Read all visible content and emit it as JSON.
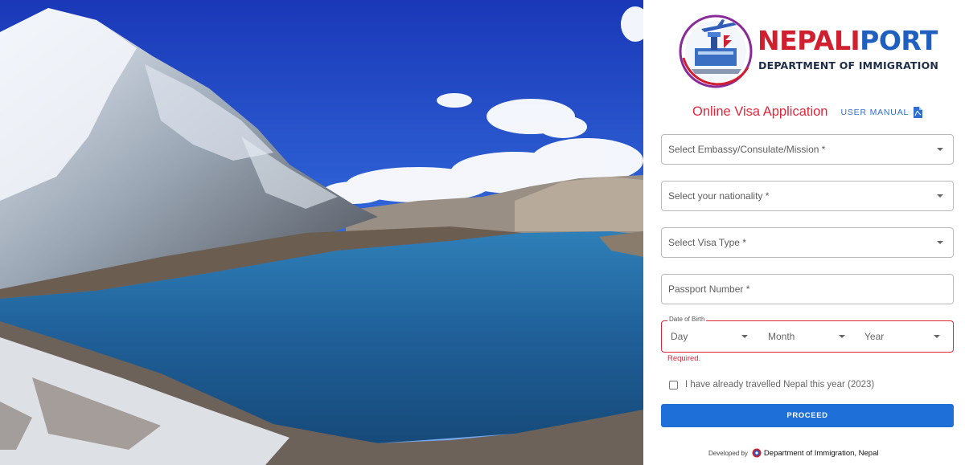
{
  "brand": {
    "title_part1": "NEPALI",
    "title_part2": "PORT",
    "subtitle": "DEPARTMENT OF IMMIGRATION"
  },
  "form": {
    "title": "Online Visa Application",
    "user_manual_label": "USER MANUAL",
    "embassy_placeholder": "Select Embassy/Consulate/Mission *",
    "nationality_placeholder": "Select your nationality *",
    "visa_type_placeholder": "Select Visa Type *",
    "passport_placeholder": "Passport Number *",
    "dob": {
      "legend": "Date of Birth",
      "day_placeholder": "Day",
      "month_placeholder": "Month",
      "year_placeholder": "Year",
      "error": "Required."
    },
    "travelled_checkbox_label": "I have already travelled Nepal this year (2023)",
    "travelled_checked": false,
    "proceed_label": "PROCEED"
  },
  "footer": {
    "developed_by": "Developed by",
    "org": "Department of Immigration, Nepal"
  },
  "icons": {
    "user_manual": "pdf-icon",
    "footer": "immigration-emblem-icon",
    "select": "caret-down-icon"
  },
  "colors": {
    "brand_red": "#d0202f",
    "brand_blue": "#1f5fbf",
    "primary_button": "#1f6fd8",
    "error": "#e0263a"
  }
}
